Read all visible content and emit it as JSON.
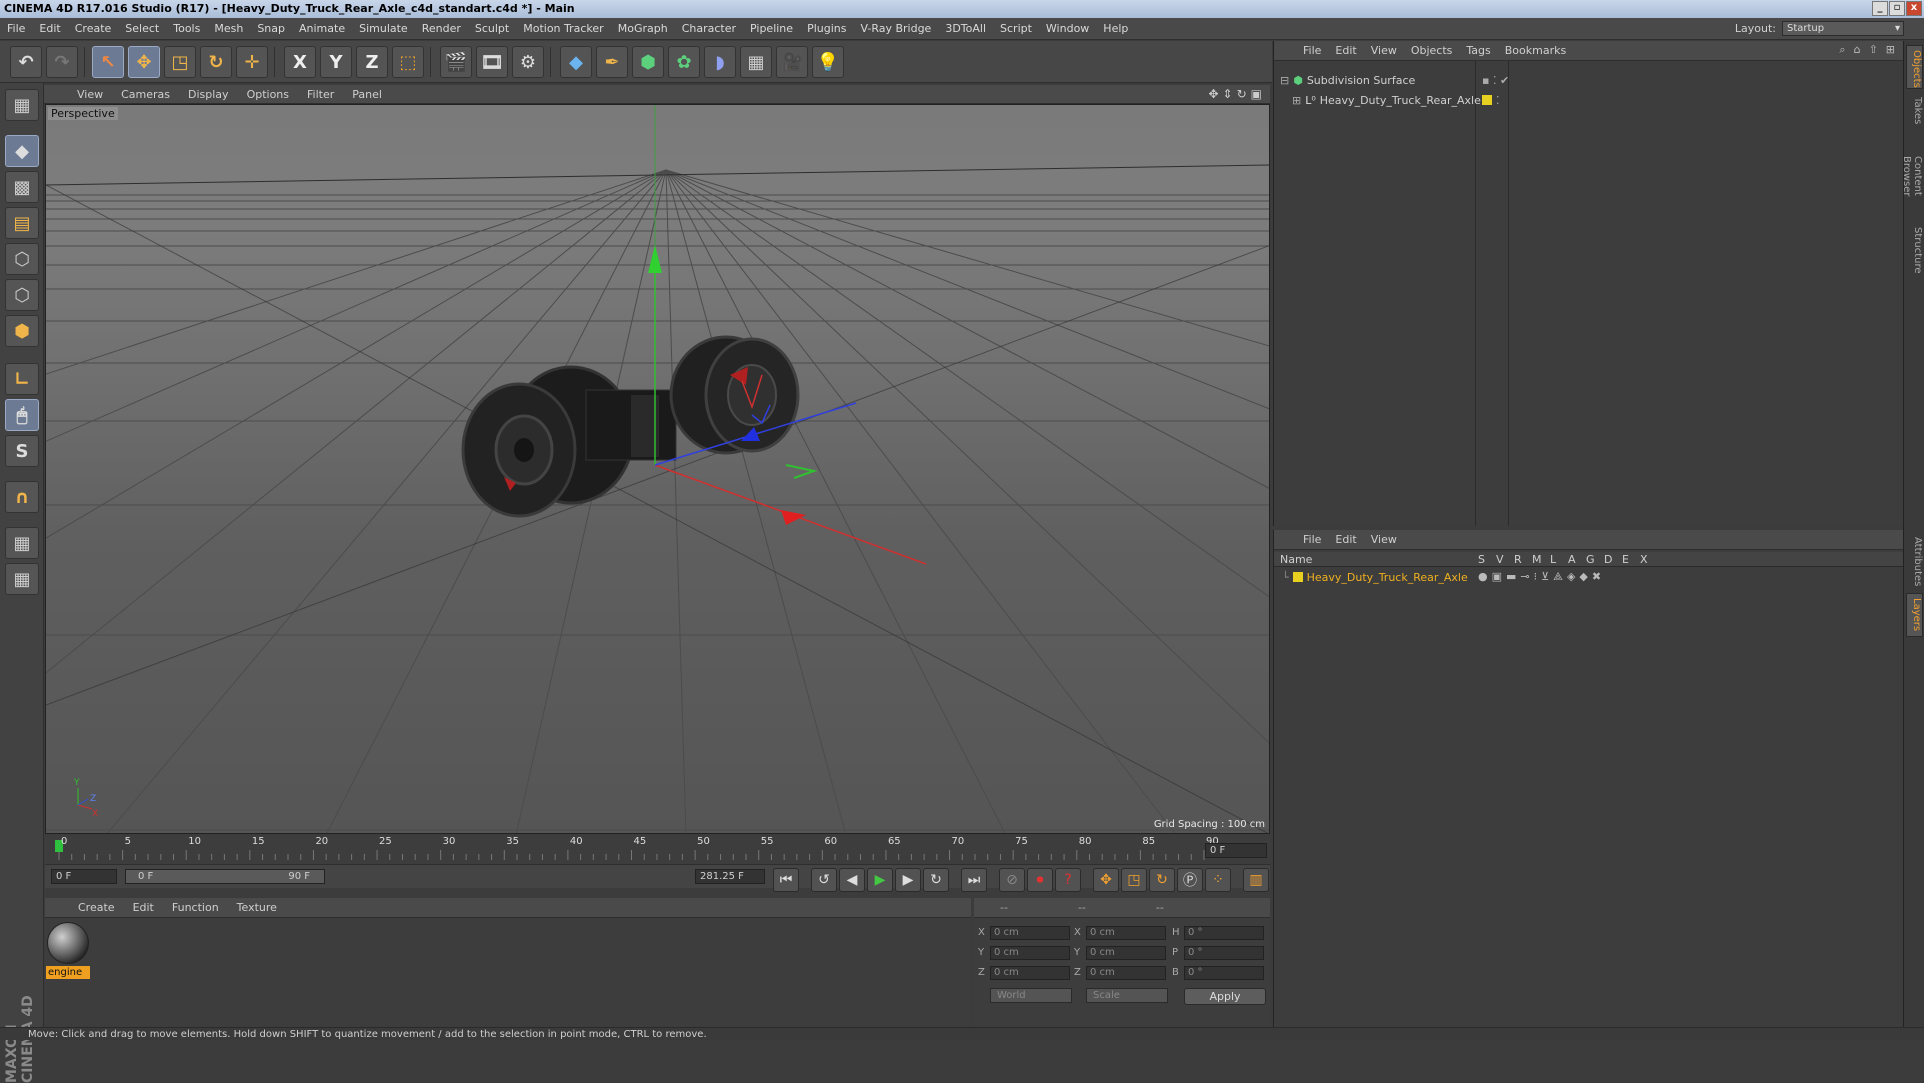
{
  "window": {
    "title": "CINEMA 4D R17.016 Studio (R17) - [Heavy_Duty_Truck_Rear_Axle_c4d_standart.c4d *] - Main",
    "btn_min": "_",
    "btn_max": "▫",
    "btn_close": "x"
  },
  "menubar": {
    "items": [
      "File",
      "Edit",
      "Create",
      "Select",
      "Tools",
      "Mesh",
      "Snap",
      "Animate",
      "Simulate",
      "Render",
      "Sculpt",
      "Motion Tracker",
      "MoGraph",
      "Character",
      "Pipeline",
      "Plugins",
      "V-Ray Bridge",
      "3DToAll",
      "Script",
      "Window",
      "Help"
    ],
    "layout_label": "Layout:",
    "layout_value": "Startup"
  },
  "toolbar": {
    "x_label": "X",
    "y_label": "Y",
    "z_label": "Z"
  },
  "left_tools": {
    "s_label": "S"
  },
  "branding": "MAXON CINEMA 4D",
  "viewport": {
    "menu": [
      "View",
      "Cameras",
      "Display",
      "Options",
      "Filter",
      "Panel"
    ],
    "camera_label": "Perspective",
    "grid_spacing": "Grid Spacing : 100 cm",
    "axis_y": "Y",
    "axis_x": "X",
    "axis_z": "Z"
  },
  "timeline": {
    "ticks": [
      "0",
      "5",
      "10",
      "15",
      "20",
      "25",
      "30",
      "35",
      "40",
      "45",
      "50",
      "55",
      "60",
      "65",
      "70",
      "75",
      "80",
      "85",
      "90"
    ],
    "current_frame": "0 F",
    "start_field": "0 F",
    "range_start": "0 F",
    "range_end": "90 F",
    "end_field": "281.25 F"
  },
  "materials": {
    "menu": [
      "Create",
      "Edit",
      "Function",
      "Texture"
    ],
    "items": [
      {
        "name": "engine"
      }
    ]
  },
  "coordinates": {
    "headers": [
      "--",
      "--",
      "--"
    ],
    "rows": [
      {
        "l1": "X",
        "v1": "0 cm",
        "l2": "X",
        "v2": "0 cm",
        "l3": "H",
        "v3": "0 °"
      },
      {
        "l1": "Y",
        "v1": "0 cm",
        "l2": "Y",
        "v2": "0 cm",
        "l3": "P",
        "v3": "0 °"
      },
      {
        "l1": "Z",
        "v1": "0 cm",
        "l2": "Z",
        "v2": "0 cm",
        "l3": "B",
        "v3": "0 °"
      }
    ],
    "mode": "World",
    "mode2": "Scale",
    "apply": "Apply"
  },
  "status": "Move: Click and drag to move elements. Hold down SHIFT to quantize movement / add to the selection in point mode, CTRL to remove.",
  "object_manager": {
    "menu": [
      "File",
      "Edit",
      "View",
      "Objects",
      "Tags",
      "Bookmarks"
    ],
    "objects": [
      {
        "name": "Subdivision Surface"
      },
      {
        "name": "Heavy_Duty_Truck_Rear_Axle"
      }
    ]
  },
  "layer_manager": {
    "menu": [
      "File",
      "Edit",
      "View"
    ],
    "name_header": "Name",
    "columns": [
      "S",
      "V",
      "R",
      "M",
      "L",
      "A",
      "G",
      "D",
      "E",
      "X"
    ],
    "layers": [
      {
        "name": "Heavy_Duty_Truck_Rear_Axle",
        "color": "#e8d020"
      }
    ]
  },
  "side_tabs": [
    "Objects",
    "Takes",
    "Content Browser",
    "Structure",
    "Attributes",
    "Layers"
  ],
  "colors": {
    "accent": "#f0a030",
    "selected_tool": "#6c7b93",
    "layer_text": "#f0b020"
  }
}
